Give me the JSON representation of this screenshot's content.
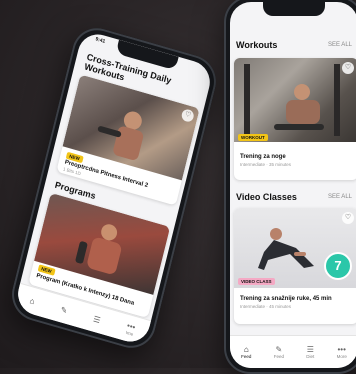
{
  "left_phone": {
    "status_time": "9:41",
    "section_title": "Cross-Training Daily Workouts",
    "card1": {
      "badge": "NEW",
      "title": "Preoptrcdna Pitness Interval 2",
      "sub": "1 Bits 1D"
    },
    "programs_title": "Programs",
    "card2": {
      "badge": "NEW",
      "title": "Program (Kratko k Intenzy) 18 Dana",
      "sub": ""
    },
    "tabs": [
      {
        "icon": "⌂",
        "label": ""
      },
      {
        "icon": "✎",
        "label": ""
      },
      {
        "icon": "☰",
        "label": ""
      },
      {
        "icon": "•••",
        "label": "Ime"
      }
    ]
  },
  "right_phone": {
    "workouts_title": "Workouts",
    "workouts_see_all": "SEE ALL",
    "workout_card": {
      "badge": "WORKOUT",
      "title": "Trening za noge",
      "sub": "Intermediate · 35 minutes"
    },
    "video_title": "Video Classes",
    "video_see_all": "SEE ALL",
    "video_card": {
      "badge": "VIDEO CLASS",
      "number": "7",
      "title": "Trening za snažnije ruke, 45 min",
      "sub": "Intermediate · 45 minutes"
    },
    "tabs": [
      {
        "icon": "⌂",
        "label": "Feed"
      },
      {
        "icon": "✎",
        "label": "Feed"
      },
      {
        "icon": "☰",
        "label": "Diet"
      },
      {
        "icon": "•••",
        "label": "More"
      }
    ]
  },
  "colors": {
    "accent_yellow": "#f2c417",
    "badge_pink": "#f4a9c4",
    "teal": "#2bc7a9"
  }
}
